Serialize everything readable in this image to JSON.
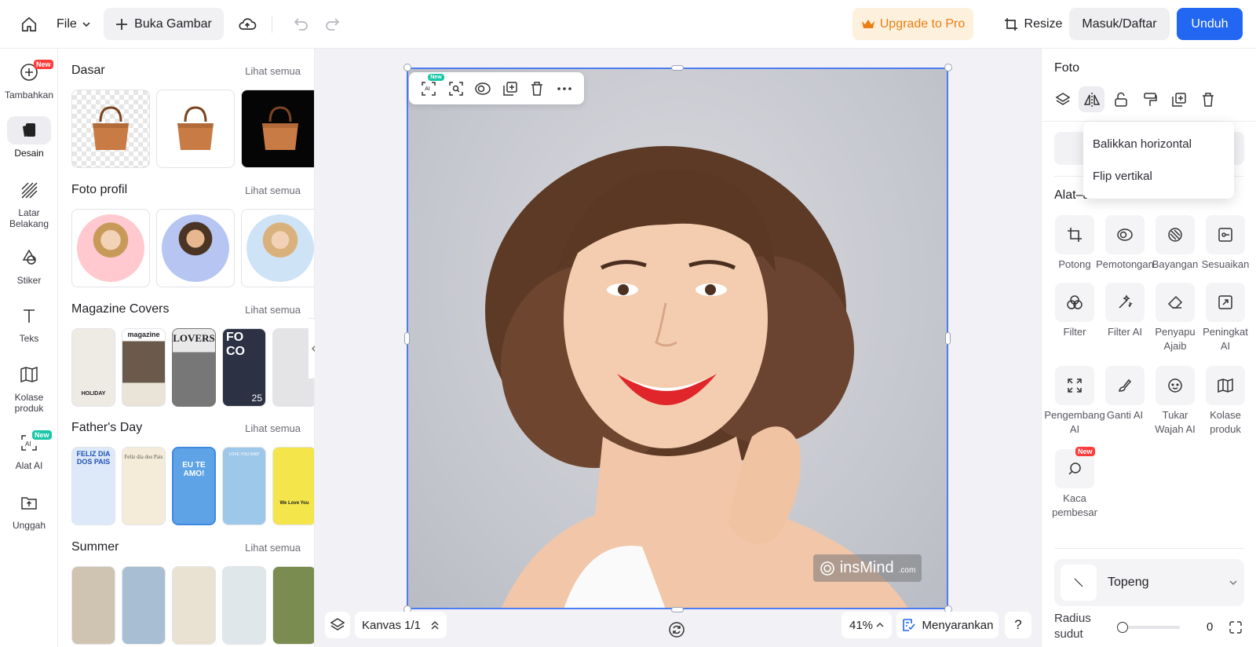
{
  "topbar": {
    "file_label": "File",
    "open_image_label": "Buka Gambar",
    "upgrade_label": "Upgrade to Pro",
    "resize_label": "Resize",
    "login_label": "Masuk/Daftar",
    "download_label": "Unduh"
  },
  "rail": {
    "items": [
      {
        "label": "Tambahkan",
        "icon": "plus-circle-icon",
        "badge": "New"
      },
      {
        "label": "Desain",
        "icon": "design-icon"
      },
      {
        "label": "Latar Belakang",
        "icon": "background-icon"
      },
      {
        "label": "Stiker",
        "icon": "sticker-icon"
      },
      {
        "label": "Teks",
        "icon": "text-icon"
      },
      {
        "label": "Kolase produk",
        "icon": "collage-icon"
      },
      {
        "label": "Alat AI",
        "icon": "ai-tool-icon",
        "badge": "New"
      },
      {
        "label": "Unggah",
        "icon": "upload-icon"
      }
    ]
  },
  "panel": {
    "see_all": "Lihat semua",
    "sections": [
      {
        "title": "Dasar"
      },
      {
        "title": "Foto profil"
      },
      {
        "title": "Magazine Covers"
      },
      {
        "title": "Father's Day"
      },
      {
        "title": "Summer"
      }
    ],
    "magazine_thumbs": [
      "HOLIDAY",
      "magazine",
      "LOVERS",
      "FO CO",
      "25"
    ],
    "fathers_thumbs": [
      "FELIZ DIA DOS PAIS",
      "Feliz dia dos Pais",
      "EU TE AMO!",
      "LOVE YOU DAD!",
      "We Love You"
    ]
  },
  "canvas": {
    "floating_toolbar": {
      "ai_badge": "New",
      "ai_label": "AI"
    },
    "watermark": "insMind",
    "watermark_suffix": ".com",
    "canvas_count": "Kanvas 1/1",
    "zoom": "41%",
    "suggest_label": "Menyarankan",
    "help_label": "?"
  },
  "right_panel": {
    "title": "Foto",
    "flip_menu": [
      "Balikkan horizontal",
      "Flip vertikal"
    ],
    "tools_title": "Alat–alat",
    "tools": [
      {
        "label": "Potong",
        "icon": "crop-icon"
      },
      {
        "label": "Pemotongan",
        "icon": "cutout-icon"
      },
      {
        "label": "Bayangan",
        "icon": "shadow-icon"
      },
      {
        "label": "Sesuaikan",
        "icon": "adjust-icon"
      },
      {
        "label": "Filter",
        "icon": "filter-icon"
      },
      {
        "label": "Filter AI",
        "icon": "ai-filter-icon"
      },
      {
        "label": "Penyapu Ajaib",
        "icon": "magic-eraser-icon"
      },
      {
        "label": "Peningkat AI",
        "icon": "enhancer-icon"
      },
      {
        "label": "Pengembang AI",
        "icon": "expand-icon"
      },
      {
        "label": "Ganti AI",
        "icon": "replace-icon"
      },
      {
        "label": "Tukar Wajah AI",
        "icon": "face-swap-icon"
      },
      {
        "label": "Kolase produk",
        "icon": "collage-icon"
      },
      {
        "label": "Kaca pembesar",
        "icon": "magnifier-icon",
        "badge": "New"
      }
    ],
    "mask_label": "Topeng",
    "radius_label": "Radius sudut",
    "radius_value": "0"
  },
  "colors": {
    "accent": "#2167f2",
    "upgrade_text": "#e97f16",
    "upgrade_bg": "#fdf0dc",
    "badge_red": "#ff3b3b",
    "badge_teal": "#17c7a6"
  }
}
